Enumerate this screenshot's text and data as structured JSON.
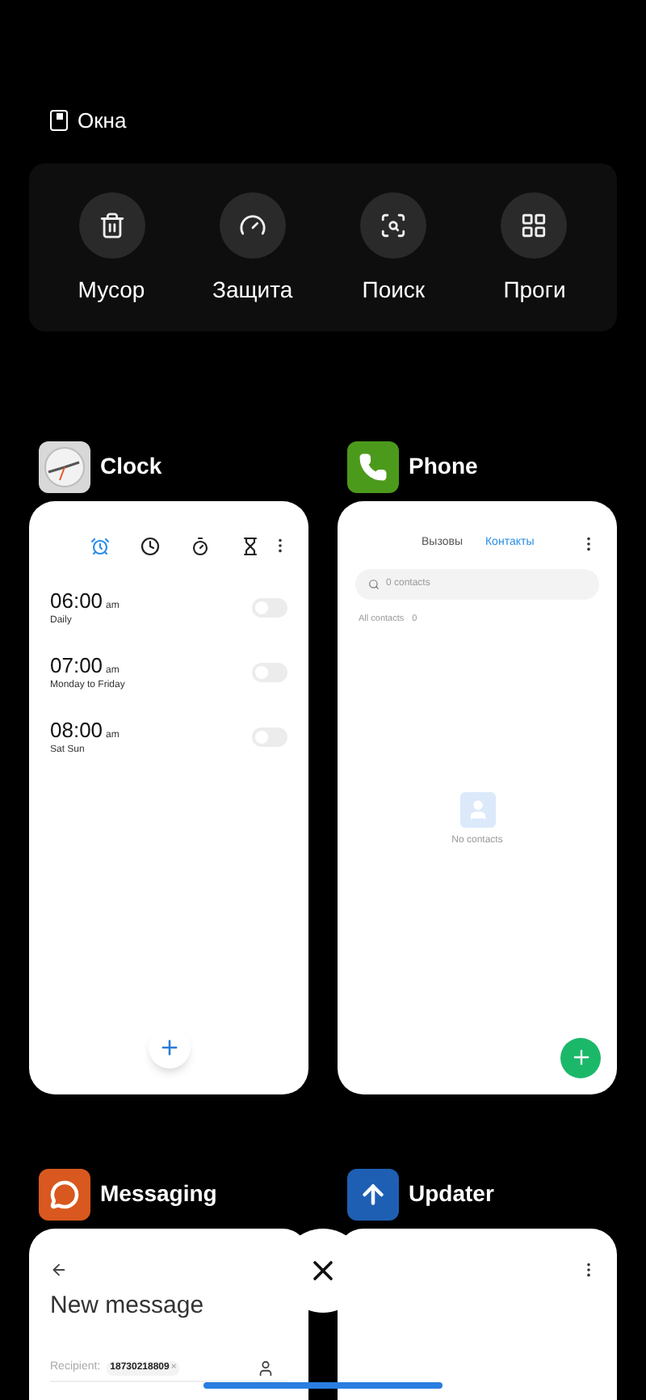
{
  "header": {
    "title": "Окна"
  },
  "quick_actions": [
    {
      "label": "Мусор",
      "kind": "trash"
    },
    {
      "label": "Защита",
      "kind": "shield"
    },
    {
      "label": "Поиск",
      "kind": "search"
    },
    {
      "label": "Проги",
      "kind": "apps"
    }
  ],
  "apps": [
    {
      "name": "Clock",
      "kind": "clock",
      "tabs": [
        {
          "kind": "alarm",
          "selected": true
        },
        {
          "kind": "clock",
          "selected": false
        },
        {
          "kind": "stopwatch",
          "selected": false
        },
        {
          "kind": "timer",
          "selected": false
        }
      ],
      "alarms": [
        {
          "time": "06:00",
          "ampm": "am",
          "label": "Daily",
          "on": false
        },
        {
          "time": "07:00",
          "ampm": "am",
          "label": "Monday to Friday",
          "on": false
        },
        {
          "time": "08:00",
          "ampm": "am",
          "label": "Sat Sun",
          "on": false
        }
      ]
    },
    {
      "name": "Phone",
      "kind": "phone",
      "tabs": [
        {
          "label": "Вызовы",
          "selected": false
        },
        {
          "label": "Контакты",
          "selected": true
        }
      ],
      "search": {
        "placeholder": "0 contacts"
      },
      "section": "All contacts",
      "count": "0",
      "empty": "No contacts"
    },
    {
      "name": "Messaging",
      "kind": "messaging",
      "title": "New message",
      "recipient_label": "Recipient:",
      "recipient": "18730218809",
      "chip_remove": "×"
    },
    {
      "name": "Updater",
      "kind": "updater"
    }
  ]
}
